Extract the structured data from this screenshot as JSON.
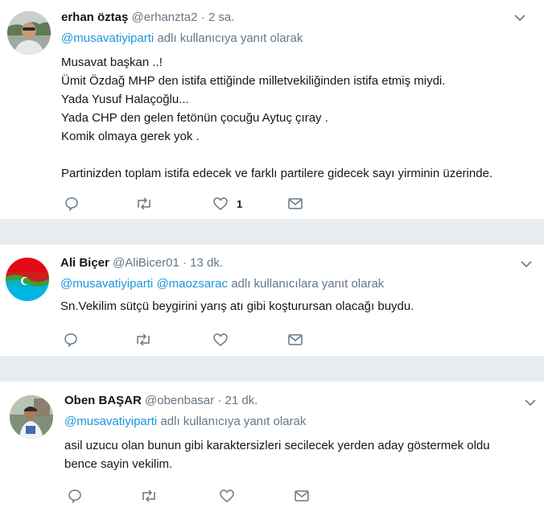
{
  "colors": {
    "link": "#1b95e0",
    "muted": "#657786",
    "divider": "#e6ecf0",
    "icon": "#657786"
  },
  "tweets": [
    {
      "name": "erhan öztaş",
      "handle": "@erhanzta2",
      "time": "2 sa.",
      "reply_mentions": [
        "@musavatiyiparti"
      ],
      "reply_suffix": "adlı kullanıcıya yanıt olarak",
      "text_lines": [
        "Musavat başkan ..!",
        "Ümit Özdağ MHP den istifa ettiğinde milletvekiliğinden istifa etmiş miydi.",
        "Yada Yusuf Halaçoğlu...",
        "Yada CHP den gelen fetönün çocuğu Aytuç çıray .",
        "Komik olmaya gerek yok .",
        "",
        "Partinizden toplam istifa edecek ve farklı partilere gidecek sayı yirminin üzerinde."
      ],
      "like_count": "1",
      "icons": [
        "reply-icon",
        "retweet-icon",
        "like-icon",
        "message-icon",
        "chevron-down-icon"
      ]
    },
    {
      "name": "Ali Biçer",
      "handle": "@AliBicer01",
      "time": "13 dk.",
      "reply_mentions": [
        "@musavatiyiparti",
        "@maozsarac"
      ],
      "reply_suffix": "adlı kullanıcılara yanıt olarak",
      "text_lines": [
        "Sn.Vekilim sütçü beygirini yarış atı gibi koşturursan olacağı buydu."
      ],
      "like_count": "",
      "icons": [
        "reply-icon",
        "retweet-icon",
        "like-icon",
        "message-icon",
        "chevron-down-icon"
      ]
    },
    {
      "name": "Oben BAŞAR",
      "handle": "@obenbasar",
      "time": "21 dk.",
      "reply_mentions": [
        "@musavatiyiparti"
      ],
      "reply_suffix": "adlı kullanıcıya yanıt olarak",
      "text_lines": [
        "asil uzucu olan bunun gibi karaktersizleri secilecek yerden aday göstermek oldu",
        "bence sayin vekilim."
      ],
      "like_count": "",
      "icons": [
        "reply-icon",
        "retweet-icon",
        "like-icon",
        "message-icon",
        "chevron-down-icon"
      ]
    }
  ],
  "separator": "·"
}
